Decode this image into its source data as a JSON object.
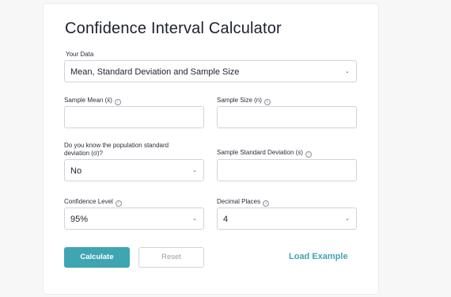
{
  "title": "Confidence Interval Calculator",
  "your_data": {
    "label": "Your Data",
    "value": "Mean, Standard Deviation and Sample Size"
  },
  "sample_mean": {
    "label": "Sample Mean (x̄)",
    "value": ""
  },
  "sample_size": {
    "label": "Sample Size (n)",
    "value": ""
  },
  "know_sd": {
    "label_line1": "Do you know the population standard",
    "label_line2": "deviation (σ)?",
    "value": "No"
  },
  "sample_sd": {
    "label": "Sample Standard Deviation (s)",
    "value": ""
  },
  "confidence": {
    "label": "Confidence Level",
    "value": "95%"
  },
  "decimals": {
    "label": "Decimal Places",
    "value": "4"
  },
  "info_glyph": "i",
  "chevron_glyph": "⌄",
  "buttons": {
    "calculate": "Calculate",
    "reset": "Reset",
    "load_example": "Load Example"
  },
  "colors": {
    "accent": "#3fa5b3"
  }
}
